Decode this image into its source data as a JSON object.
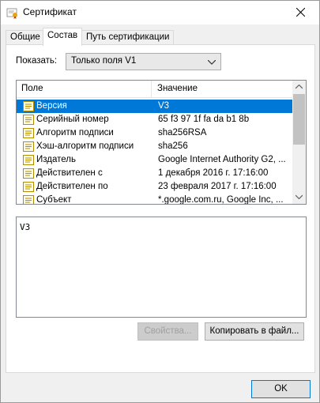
{
  "window": {
    "title": "Сертификат"
  },
  "tabs": [
    {
      "label": "Общие"
    },
    {
      "label": "Состав"
    },
    {
      "label": "Путь сертификации"
    }
  ],
  "show": {
    "label": "Показать:",
    "selected": "Только поля V1"
  },
  "list": {
    "columns": [
      "Поле",
      "Значение"
    ],
    "rows": [
      {
        "field": "Версия",
        "value": "V3",
        "selected": true
      },
      {
        "field": "Серийный номер",
        "value": "65 f3 97 1f fa da b1 8b"
      },
      {
        "field": "Алгоритм подписи",
        "value": "sha256RSA"
      },
      {
        "field": "Хэш-алгоритм подписи",
        "value": "sha256"
      },
      {
        "field": "Издатель",
        "value": "Google Internet Authority G2, ..."
      },
      {
        "field": "Действителен с",
        "value": "1 декабря 2016 г. 17:16:00"
      },
      {
        "field": "Действителен по",
        "value": "23 февраля 2017 г. 17:16:00"
      },
      {
        "field": "Субъект",
        "value": "*.google.com.ru, Google Inc, ..."
      }
    ]
  },
  "detail": {
    "text": "V3"
  },
  "buttons": {
    "properties": "Свойства...",
    "copy": "Копировать в файл...",
    "ok": "OK"
  },
  "colors": {
    "selection": "#0078d7",
    "window_bg": "#f0f0f0"
  }
}
